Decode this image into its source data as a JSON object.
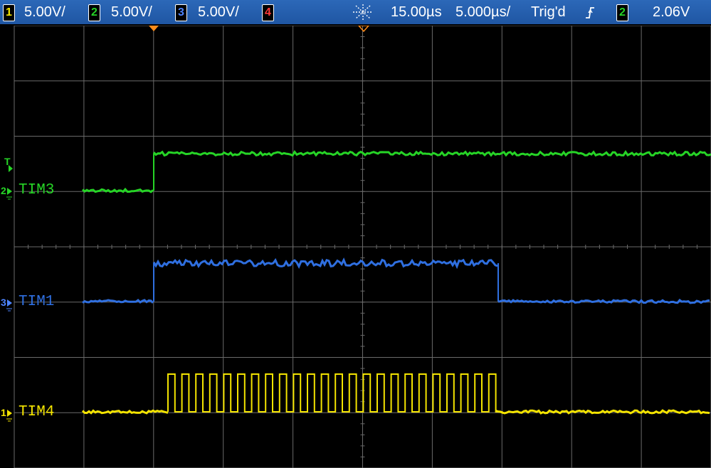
{
  "header": {
    "ch1": {
      "num": "1",
      "scale": "5.00V/"
    },
    "ch2": {
      "num": "2",
      "scale": "5.00V/"
    },
    "ch3": {
      "num": "3",
      "scale": "5.00V/"
    },
    "ch4": {
      "num": "4"
    },
    "time_delay": "15.00µs",
    "time_scale": "5.000µs/",
    "trigger_status": "Trig'd",
    "trigger_slope_icon": "rising-edge-icon",
    "trigger_channel": "2",
    "trigger_level": "2.06V"
  },
  "colors": {
    "ch1": "#f4e400",
    "ch2": "#26d426",
    "ch3": "#2f6fe0",
    "grid": "#6a6a6a",
    "marker_orange": "#ff8c1a"
  },
  "channels": [
    {
      "id": "2",
      "label": "TIM3",
      "color": "#26d426"
    },
    {
      "id": "3",
      "label": "TIM1",
      "color": "#2f6fe0"
    },
    {
      "id": "1",
      "label": "TIM4",
      "color": "#f4e400"
    }
  ],
  "trigger_marker": "T"
}
